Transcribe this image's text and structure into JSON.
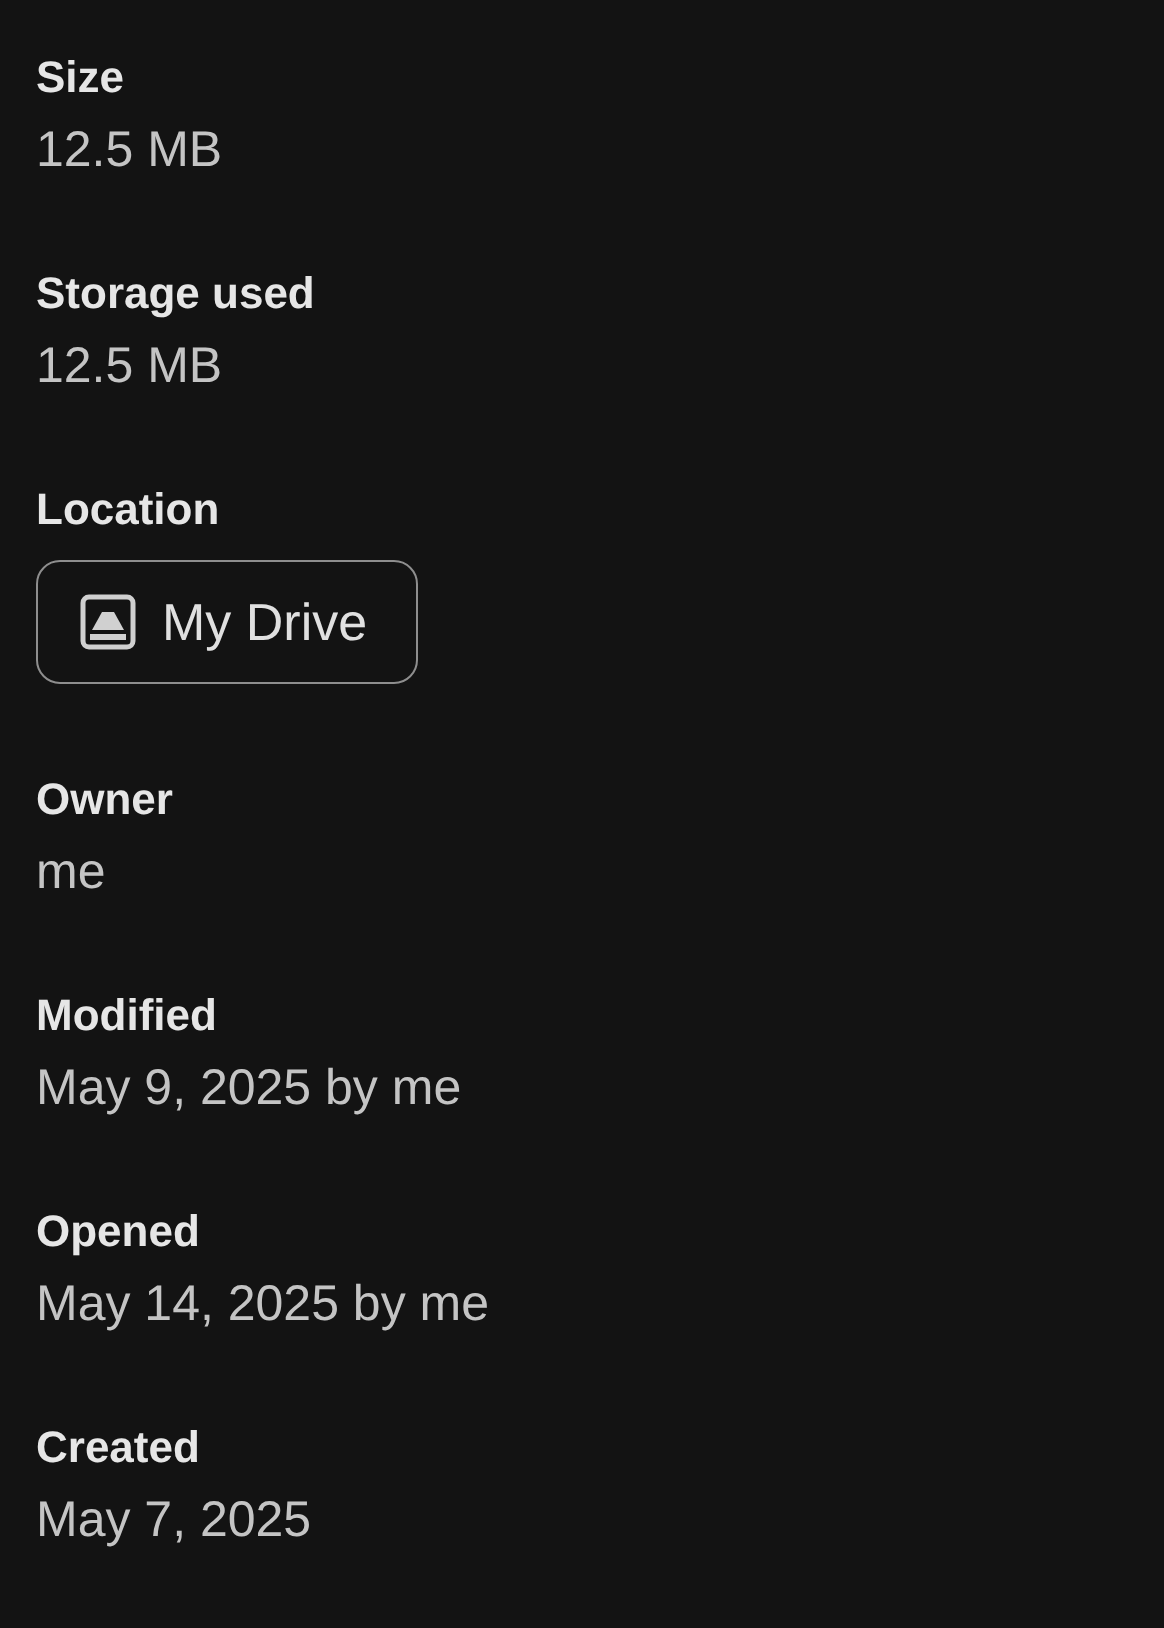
{
  "details": [
    {
      "kind": "text",
      "label": "Size",
      "value": "12.5 MB"
    },
    {
      "kind": "text",
      "label": "Storage used",
      "value": "12.5 MB"
    },
    {
      "kind": "chip",
      "label": "Location",
      "value": "My Drive"
    },
    {
      "kind": "text",
      "label": "Owner",
      "value": "me"
    },
    {
      "kind": "text",
      "label": "Modified",
      "value": "May 9, 2025 by me"
    },
    {
      "kind": "text",
      "label": "Opened",
      "value": "May 14, 2025 by me"
    },
    {
      "kind": "text",
      "label": "Created",
      "value": "May 7, 2025"
    }
  ]
}
